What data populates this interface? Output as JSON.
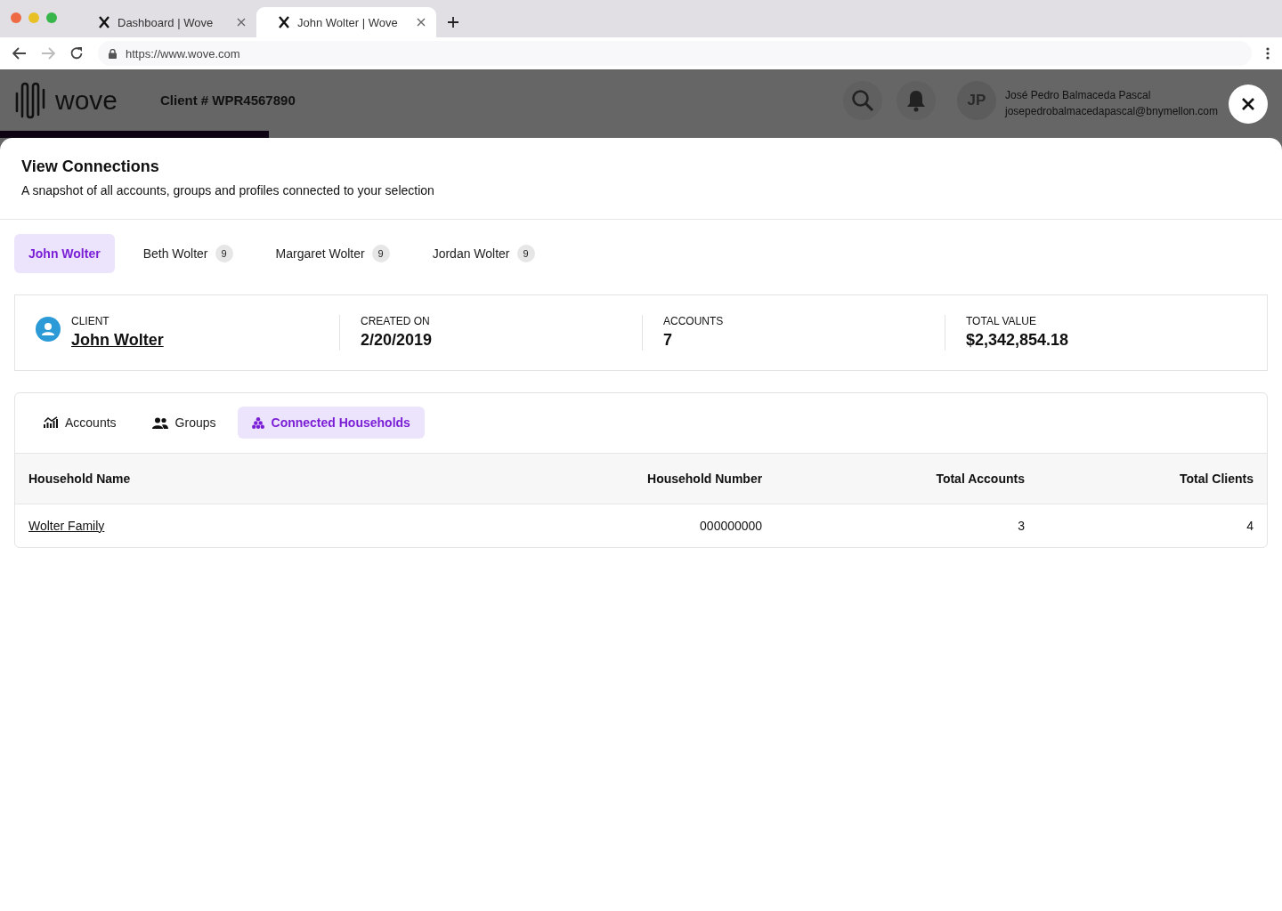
{
  "browser": {
    "tabs": [
      {
        "title": "Dashboard | Wove",
        "selected": false
      },
      {
        "title": "John Wolter | Wove",
        "selected": true
      }
    ],
    "url": "https://www.wove.com"
  },
  "header": {
    "logo": "wove",
    "client_number": "Client # WPR4567890",
    "avatar_initials": "JP",
    "user_name": "José Pedro Balmaceda Pascal",
    "user_email": "josepedrobalmacedapascal@bnymellon.com",
    "progress": {
      "level": 0.21
    }
  },
  "modal": {
    "title": "View Connections",
    "subtitle": "A snapshot of all accounts, groups and profiles connected to your selection",
    "people": [
      {
        "name": "John Wolter",
        "selected": true
      },
      {
        "name": "Beth Wolter",
        "count": "9",
        "selected": false
      },
      {
        "name": "Margaret Wolter",
        "count": "9",
        "selected": false
      },
      {
        "name": "Jordan Wolter",
        "count": "9",
        "selected": false
      }
    ],
    "summary": [
      {
        "label": "CLIENT",
        "value": "John Wolter",
        "kind": "client"
      },
      {
        "label": "CREATED ON",
        "value": "2/20/2019",
        "kind": "plain"
      },
      {
        "label": "ACCOUNTS",
        "value": "7",
        "kind": "plain"
      },
      {
        "label": "TOTAL VALUE",
        "value": "$2,342,854.18",
        "kind": "plain"
      }
    ],
    "section_tabs": [
      {
        "label": "Accounts",
        "kind": "chart",
        "selected": false
      },
      {
        "label": "Groups",
        "kind": "people",
        "selected": false
      },
      {
        "label": "Connected Households",
        "kind": "dots",
        "selected": true
      }
    ],
    "table": {
      "columns": [
        "Household Name",
        "Household Number",
        "Total Accounts",
        "Total Clients"
      ],
      "rows": [
        [
          "Wolter Family",
          "000000000",
          "3",
          "4"
        ]
      ]
    }
  }
}
